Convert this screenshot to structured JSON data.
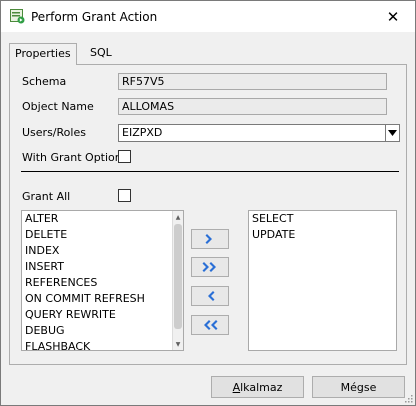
{
  "window": {
    "title": "Perform Grant Action",
    "close_glyph": "✕"
  },
  "tabs": [
    {
      "label": "Properties",
      "active": true
    },
    {
      "label": "SQL",
      "active": false
    }
  ],
  "form": {
    "schema_label": "Schema",
    "schema_value": "RF57V5",
    "object_name_label": "Object Name",
    "object_name_value": "ALLOMAS",
    "users_roles_label": "Users/Roles",
    "users_roles_value": "EIZPXD",
    "with_grant_option_label": "With Grant Option",
    "with_grant_option_checked": false,
    "grant_all_label": "Grant All",
    "grant_all_checked": false
  },
  "available_privileges": [
    "ALTER",
    "DELETE",
    "INDEX",
    "INSERT",
    "REFERENCES",
    "ON COMMIT REFRESH",
    "QUERY REWRITE",
    "DEBUG",
    "FLASHBACK"
  ],
  "selected_privileges": [
    "SELECT",
    "UPDATE"
  ],
  "move_buttons": [
    {
      "name": "move-selected-right-button",
      "icon": "single-right-arrow-icon"
    },
    {
      "name": "move-all-right-button",
      "icon": "double-right-arrow-icon"
    },
    {
      "name": "move-selected-left-button",
      "icon": "single-left-arrow-icon"
    },
    {
      "name": "move-all-left-button",
      "icon": "double-left-arrow-icon"
    }
  ],
  "buttons": {
    "apply_mnemonic": "A",
    "apply_rest": "lkalmaz",
    "cancel_label": "Mégse"
  },
  "colors": {
    "arrow_blue": "#2a6fd6",
    "border": "#adadad",
    "background": "#f0f0f0"
  }
}
